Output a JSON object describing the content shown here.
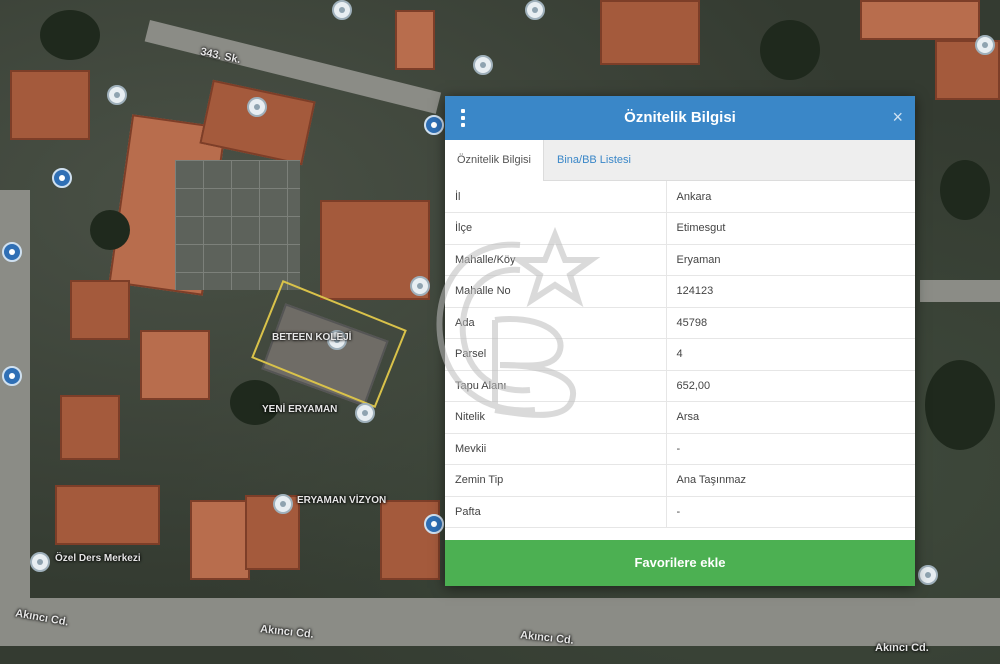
{
  "map": {
    "street_labels": [
      {
        "id": "akinci-1",
        "text": "Akıncı Cd."
      },
      {
        "id": "akinci-2",
        "text": "Akıncı Cd."
      },
      {
        "id": "akinci-3",
        "text": "Akıncı Cd."
      },
      {
        "id": "akinci-4",
        "text": "Akıncı Cd."
      },
      {
        "id": "street-top",
        "text": "343. Sk."
      }
    ],
    "poi_labels": [
      {
        "id": "poi-1",
        "text": "ERYAMAN VİZYON"
      },
      {
        "id": "poi-2",
        "text": "YENİ ERYAMAN"
      },
      {
        "id": "poi-3",
        "text": "Özel Ders Merkezi"
      },
      {
        "id": "poi-4",
        "text": "BETEEN KOLEJİ"
      }
    ],
    "parcel_color": "#d9c24a"
  },
  "dialog": {
    "title": "Öznitelik Bilgisi",
    "close_symbol": "×",
    "tabs": [
      {
        "label": "Öznitelik Bilgisi",
        "active": true
      },
      {
        "label": "Bina/BB Listesi",
        "active": false
      }
    ],
    "rows": [
      {
        "key": "İl",
        "value": "Ankara"
      },
      {
        "key": "İlçe",
        "value": "Etimesgut"
      },
      {
        "key": "Mahalle/Köy",
        "value": "Eryaman"
      },
      {
        "key": "Mahalle No",
        "value": "124123"
      },
      {
        "key": "Ada",
        "value": "45798"
      },
      {
        "key": "Parsel",
        "value": "4"
      },
      {
        "key": "Tapu Alanı",
        "value": "652,00"
      },
      {
        "key": "Nitelik",
        "value": "Arsa"
      },
      {
        "key": "Mevkii",
        "value": "-"
      },
      {
        "key": "Zemin Tip",
        "value": "Ana Taşınmaz"
      },
      {
        "key": "Pafta",
        "value": "-"
      }
    ],
    "favorite_button": "Favorilere ekle",
    "header_color": "#3a87c8",
    "button_color": "#4cb052"
  }
}
